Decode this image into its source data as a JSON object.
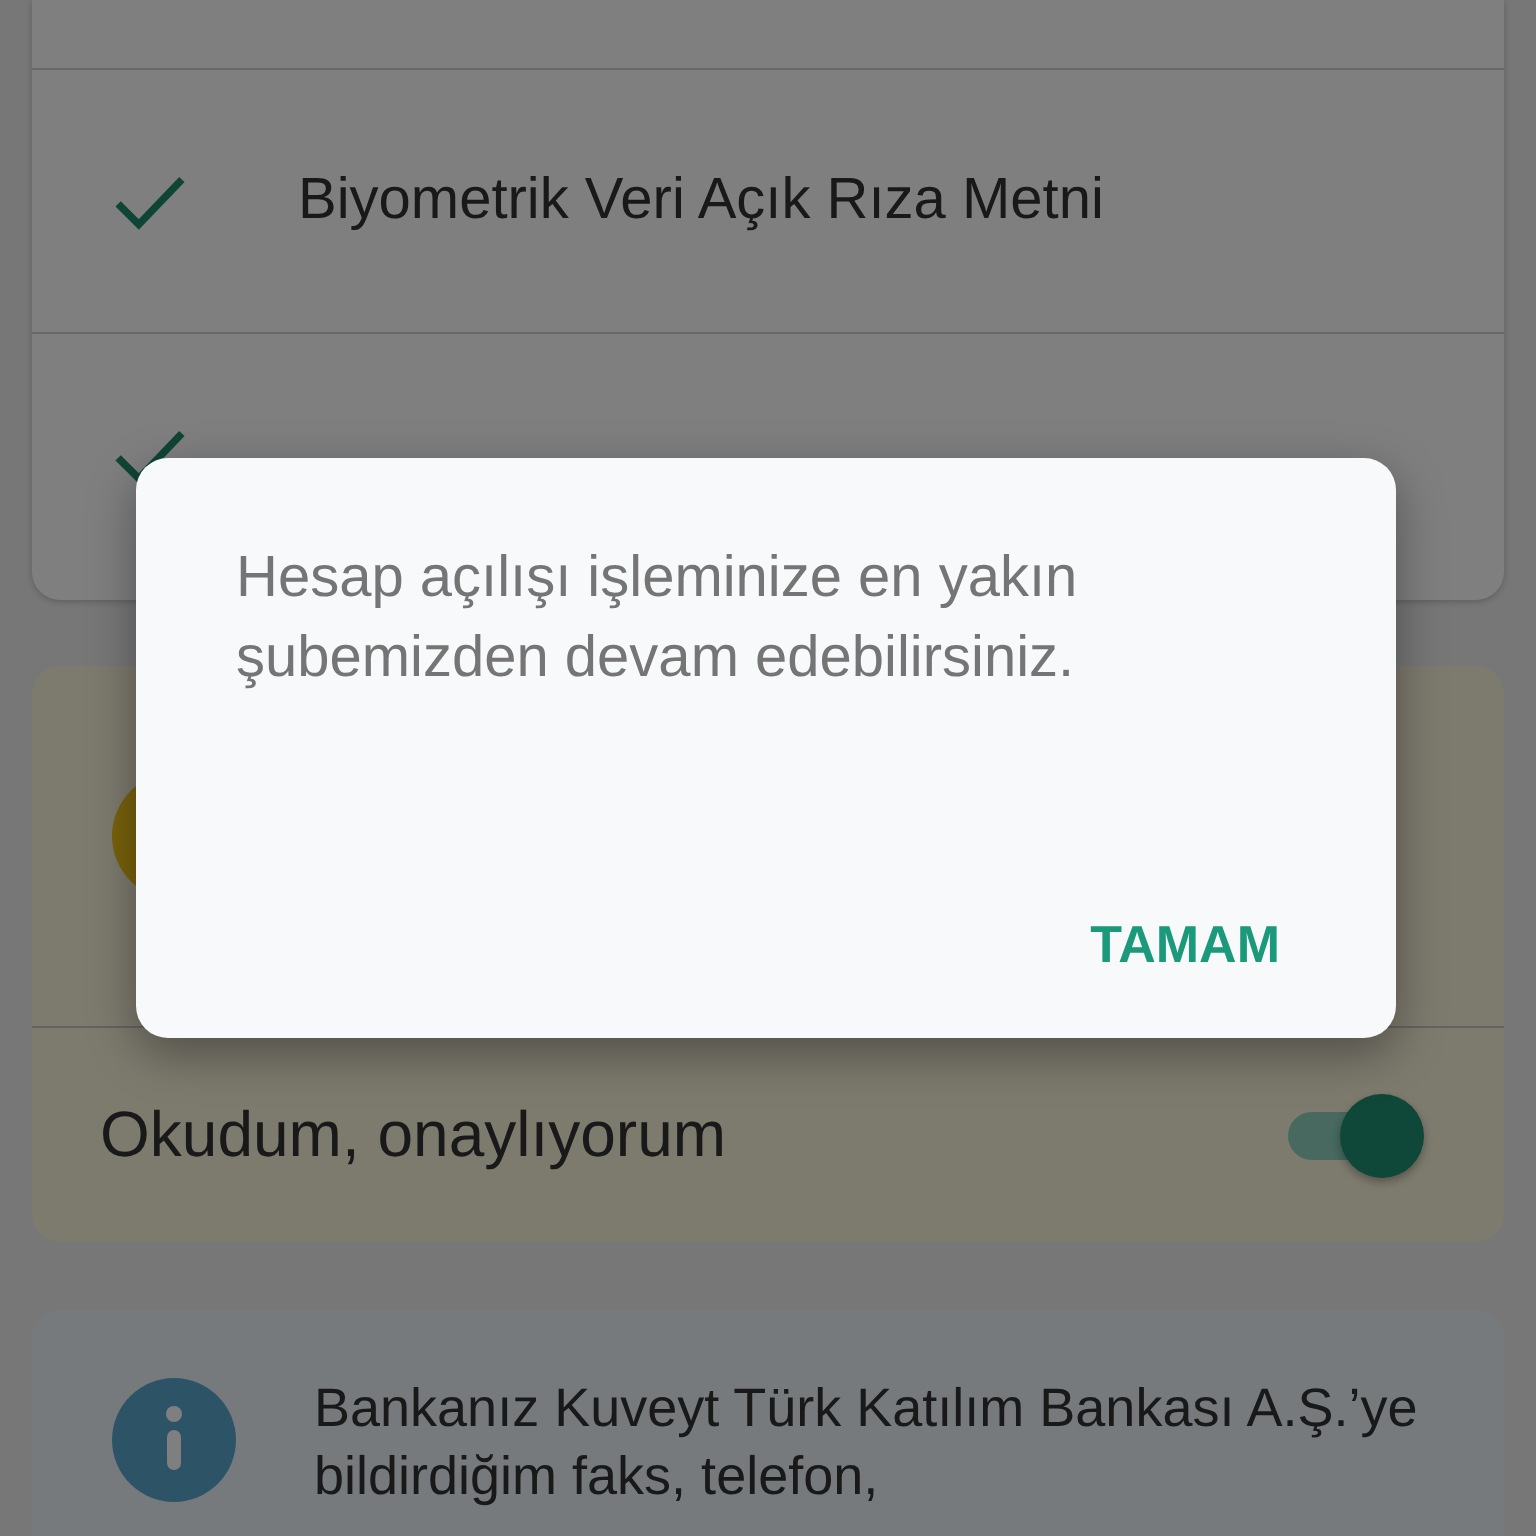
{
  "consent_list": {
    "items": [
      {
        "label": "Biyometrik Veri Açık Rıza Metni",
        "checked": true
      },
      {
        "checked": true
      }
    ]
  },
  "approval": {
    "label": "Okudum, onaylıyorum",
    "on": true
  },
  "info": {
    "text": "Bankanız Kuveyt Türk Katılım Bankası A.Ş.’ye bildirdiğim faks, telefon,"
  },
  "dialog": {
    "message": "Hesap açılışı işleminize en yakın şubemizden devam edebilirsiniz.",
    "button": "TAMAM"
  }
}
